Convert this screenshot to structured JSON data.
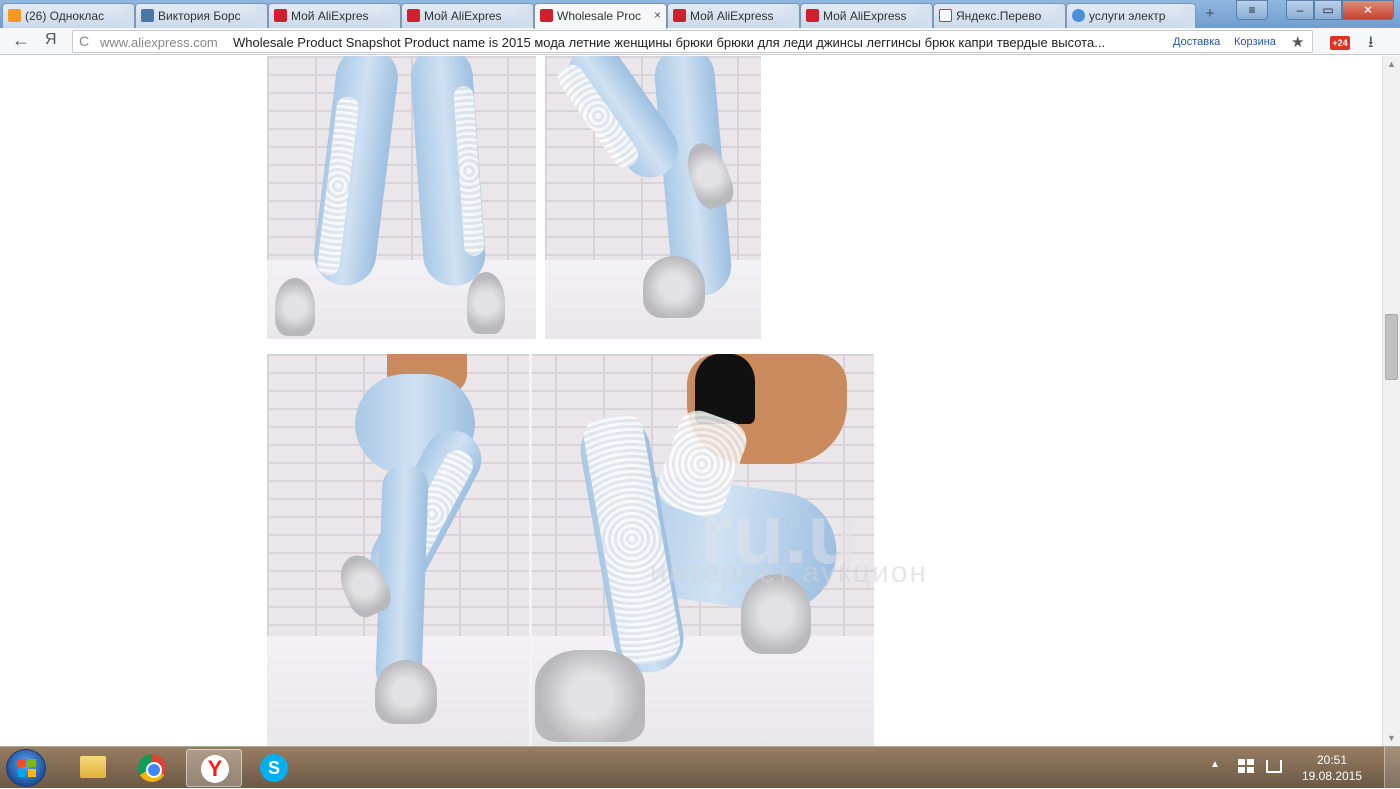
{
  "browser": {
    "tabs": [
      {
        "label": "(26) Одноклас",
        "icon": "odnoklassniki-icon",
        "active": false
      },
      {
        "label": "Виктория Борс",
        "icon": "vk-icon",
        "active": false
      },
      {
        "label": "Мой AliExpres",
        "icon": "aliexpress-icon",
        "active": false
      },
      {
        "label": "Мой AliExpres",
        "icon": "aliexpress-icon",
        "active": false
      },
      {
        "label": "Wholesale Proc",
        "icon": "aliexpress-icon",
        "active": true
      },
      {
        "label": "Мой AliExpress",
        "icon": "aliexpress-icon",
        "active": false
      },
      {
        "label": "Мой AliExpress",
        "icon": "aliexpress-icon",
        "active": false
      },
      {
        "label": "Яндекс.Перево",
        "icon": "yandex-translate-icon",
        "active": false
      },
      {
        "label": "услуги электр",
        "icon": "globe-icon",
        "active": false
      }
    ],
    "new_tab_glyph": "+",
    "close_glyph": "×",
    "omnibox": {
      "host": "www.aliexpress.com",
      "title": "Wholesale Product Snapshot Product name is 2015 мода летние женщины брюки брюки для леди джинсы леггинсы брюк капри твердые высота...",
      "link_delivery": "Доставка",
      "link_cart": "Корзина"
    },
    "back_glyph": "←",
    "yandex_glyph": "Я",
    "reload_glyph": "C",
    "star_glyph": "★",
    "extension_badge": "+24",
    "download_glyph": "⭳"
  },
  "page": {
    "watermark_line1": "ru.u",
    "watermark_line2": "интернет аукцион"
  },
  "taskbar": {
    "apps": [
      "explorer-icon",
      "chrome-icon",
      "yandex-browser-icon",
      "skype-icon"
    ],
    "active_app": "yandex-browser-icon",
    "yandex_glyph": "Y",
    "skype_glyph": "S",
    "tray_arrow": "▲",
    "time": "20:51",
    "date": "19.08.2015"
  }
}
